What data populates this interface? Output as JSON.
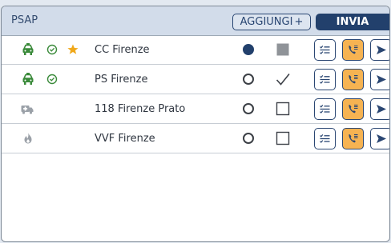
{
  "header": {
    "title": "PSAP",
    "add_label": "AGGIUNGI",
    "add_plus": "+",
    "send_label": "INVIA"
  },
  "colors": {
    "accent": "#22406c",
    "active_green": "#3a8a3a",
    "star": "#f0a81a",
    "orange_button": "#f6b352",
    "inactive_gray": "#9ba1a8"
  },
  "rows": [
    {
      "name": "CC Firenze",
      "type_icon": "car-icon",
      "connected": true,
      "favorite": true,
      "radio": "selected",
      "check": "filled-square"
    },
    {
      "name": "PS Firenze",
      "type_icon": "car-icon",
      "connected": true,
      "favorite": false,
      "radio": "unselected",
      "check": "checkmark"
    },
    {
      "name": "118 Firenze Prato",
      "type_icon": "ambulance-icon",
      "connected": false,
      "favorite": false,
      "radio": "unselected",
      "check": "empty-square"
    },
    {
      "name": "VVF Firenze",
      "type_icon": "fire-icon",
      "connected": false,
      "favorite": false,
      "radio": "unselected",
      "check": "empty-square"
    }
  ]
}
